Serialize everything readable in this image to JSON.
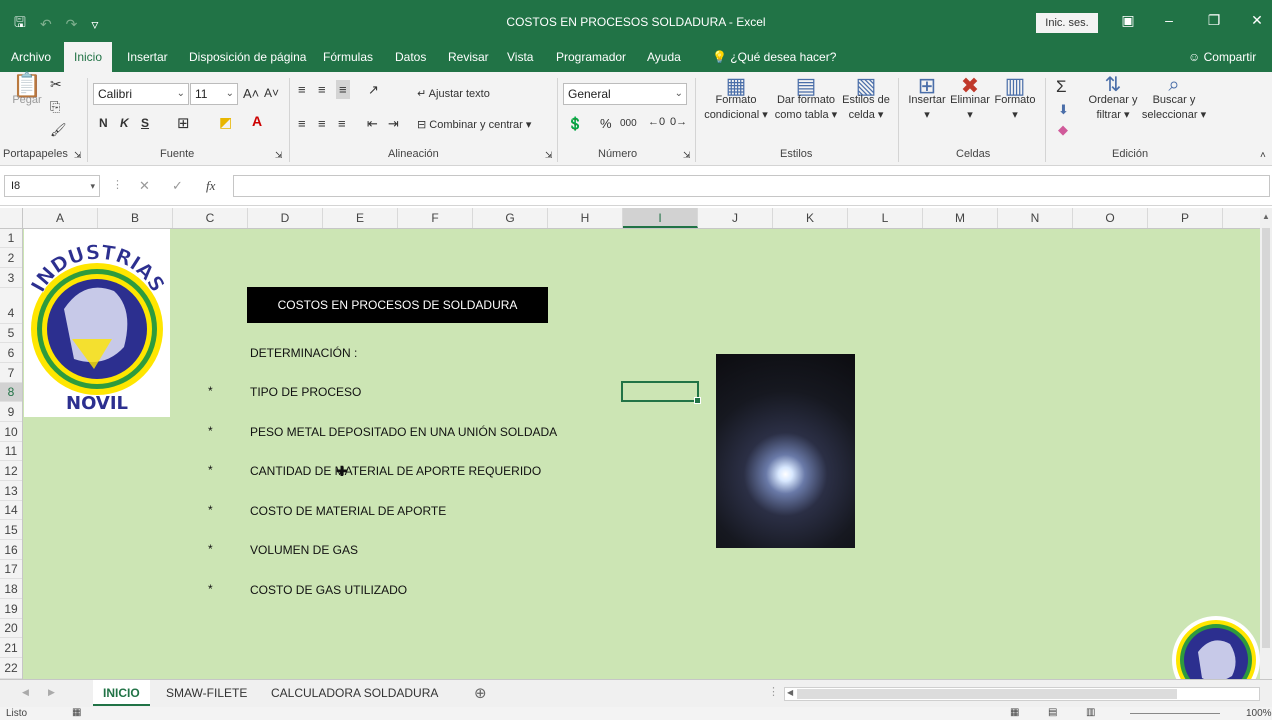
{
  "window": {
    "title": "COSTOS EN PROCESOS SOLDADURA  -  Excel",
    "signin_label": "Inic. ses.",
    "save_icon": "save-icon",
    "undo_icon": "undo-icon",
    "redo_icon": "redo-icon"
  },
  "tabs": [
    {
      "label": "Archivo"
    },
    {
      "label": "Inicio"
    },
    {
      "label": "Insertar"
    },
    {
      "label": "Disposición de página"
    },
    {
      "label": "Fórmulas"
    },
    {
      "label": "Datos"
    },
    {
      "label": "Revisar"
    },
    {
      "label": "Vista"
    },
    {
      "label": "Programador"
    },
    {
      "label": "Ayuda"
    },
    {
      "label": "¿Qué desea hacer?"
    }
  ],
  "share_label": "Compartir",
  "ribbon": {
    "clipboard": {
      "paste_label": "Pegar",
      "group": "Portapapeles"
    },
    "font": {
      "name": "Calibri",
      "size": "11",
      "bold": "N",
      "italic": "K",
      "underline": "S",
      "group": "Fuente"
    },
    "alignment": {
      "wrap_label": "Ajustar texto",
      "merge_label": "Combinar y centrar",
      "group": "Alineación"
    },
    "number": {
      "format": "General",
      "percent": "%",
      "thousands": "000",
      "group": "Número"
    },
    "styles": {
      "conditional_line1": "Formato",
      "conditional_line2": "condicional",
      "table_line1": "Dar formato",
      "table_line2": "como tabla",
      "cell_line1": "Estilos de",
      "cell_line2": "celda",
      "group": "Estilos"
    },
    "cells": {
      "insert_label": "Insertar",
      "delete_label": "Eliminar",
      "format_label": "Formato",
      "group": "Celdas"
    },
    "editing": {
      "sort_line1": "Ordenar y",
      "sort_line2": "filtrar",
      "find_line1": "Buscar y",
      "find_line2": "seleccionar",
      "group": "Edición"
    }
  },
  "formula_bar": {
    "name_box": "I8",
    "fx": "fx",
    "value": ""
  },
  "columns": [
    "A",
    "B",
    "C",
    "D",
    "E",
    "F",
    "G",
    "H",
    "I",
    "J",
    "K",
    "L",
    "M",
    "N",
    "O",
    "P"
  ],
  "selected_column": "I",
  "rows": [
    "1",
    "2",
    "3",
    "4",
    "5",
    "6",
    "7",
    "8",
    "9",
    "10",
    "11",
    "12",
    "13",
    "14",
    "15",
    "16",
    "17",
    "18",
    "19",
    "20",
    "21",
    "22"
  ],
  "selected_row": "8",
  "sheet": {
    "header": "COSTOS EN PROCESOS DE SOLDADURA",
    "determination": "DETERMINACIÓN :",
    "bullet": "*",
    "items": [
      "TIPO DE PROCESO",
      "PESO METAL DEPOSITADO EN UNA UNIÓN SOLDADA",
      "CANTIDAD DE MATERIAL DE APORTE REQUERIDO",
      "COSTO DE MATERIAL DE APORTE",
      "VOLUMEN DE GAS",
      "COSTO DE GAS UTILIZADO"
    ],
    "logo_top_text": "INDUSTRIAS",
    "logo_bottom_text": "NOVIL",
    "background_color": "#cce5b4"
  },
  "sheet_tabs": [
    {
      "label": "INICIO"
    },
    {
      "label": "SMAW-FILETE"
    },
    {
      "label": "CALCULADORA SOLDADURA"
    }
  ],
  "status": {
    "ready": "Listo",
    "zoom": "100%"
  },
  "colors": {
    "excel_green": "#217346",
    "sheet_bg": "#cce5b4"
  }
}
